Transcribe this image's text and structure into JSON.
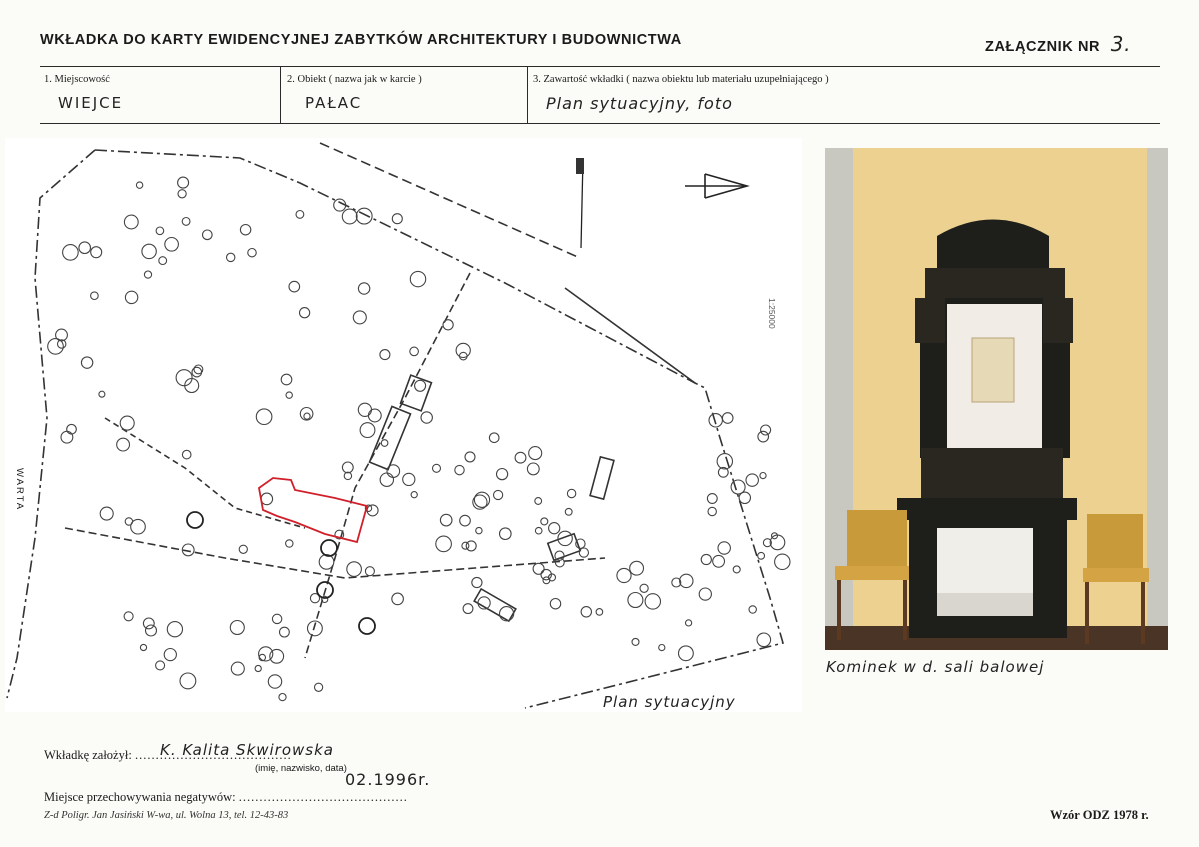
{
  "header": {
    "title": "WKŁADKA DO KARTY EWIDENCYJNEJ ZABYTKÓW ARCHITEKTURY I BUDOWNICTWA",
    "annex_label": "ZAŁĄCZNIK NR",
    "annex_number": "3."
  },
  "fields": {
    "locality": {
      "label": "1. Miejscowość",
      "value": "WIEJCE"
    },
    "object": {
      "label": "2. Obiekt ( nazwa jak w karcie )",
      "value": "PAŁAC"
    },
    "contents": {
      "label": "3. Zawartość wkładki ( nazwa obiektu lub materiału uzupełniającego )",
      "value": "Plan sytuacyjny, foto"
    }
  },
  "plan": {
    "river_label": "WARTA",
    "scale_note": "1:25000",
    "caption": "Plan sytuacyjny"
  },
  "photo": {
    "caption": "Kominek w d. sali balowej"
  },
  "footer": {
    "founded_label": "Wkładkę założył:",
    "founded_dots": "......................................",
    "founded_value": "K. Kalita Skwirowska",
    "founded_hint": "(imię, nazwisko, data)",
    "founded_date": "02.1996r.",
    "negatives_label": "Miejsce przechowywania negatywów:",
    "negatives_dots": ".........................................",
    "printer": "Z-d Poligr. Jan Jasiński W-wa, ul. Wolna 13, tel. 12-43-83",
    "model": "Wzór ODZ 1978 r."
  },
  "colors": {
    "rule": "#2a2a2a",
    "palace_outline": "#d0202a",
    "wall": "#e9cf8b",
    "fireplace": "#1e1e1a"
  }
}
